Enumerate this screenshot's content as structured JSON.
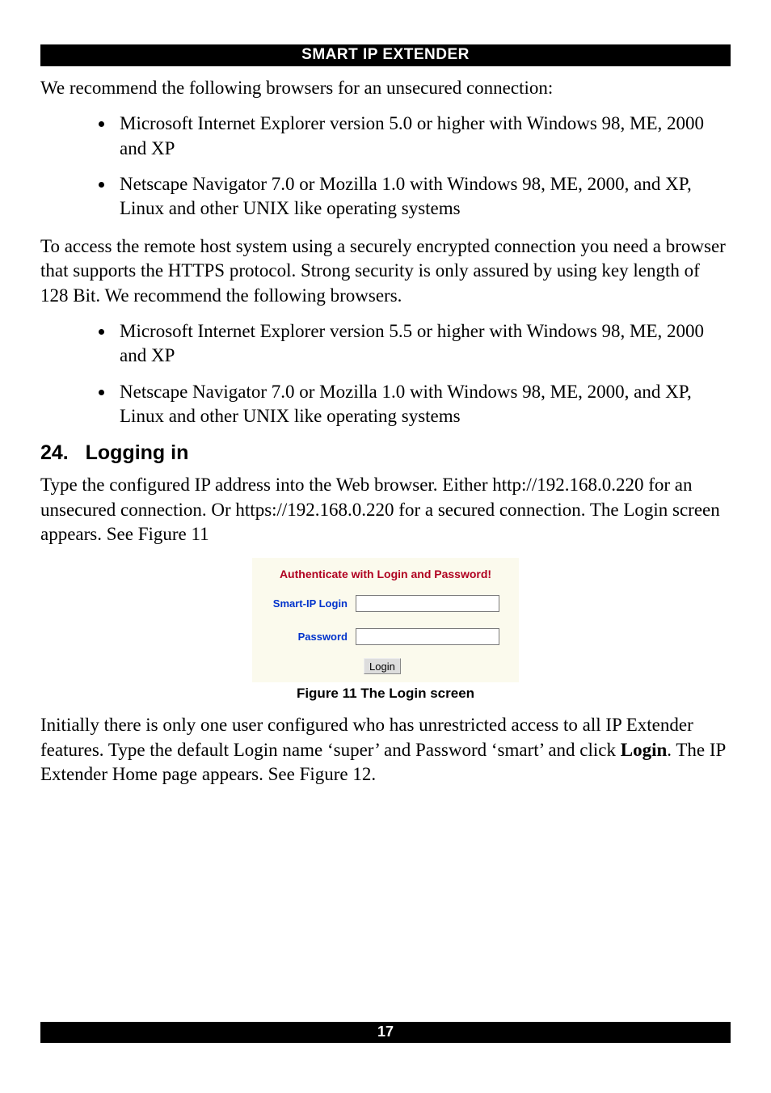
{
  "header": {
    "title": "SMART IP EXTENDER"
  },
  "intro1": "We recommend the following browsers for an unsecured connection:",
  "list1": {
    "items": [
      "Microsoft Internet Explorer version 5.0 or higher with Windows 98, ME, 2000 and XP",
      "Netscape Navigator 7.0 or Mozilla 1.0 with Windows 98, ME, 2000, and XP, Linux and other UNIX like operating systems"
    ]
  },
  "para2": "To access the remote host system using a securely encrypted connection you need a browser that supports the HTTPS protocol. Strong security is only assured by using key length of 128 Bit. We recommend the following browsers.",
  "list2": {
    "items": [
      "Microsoft Internet Explorer version 5.5 or higher with Windows 98, ME, 2000 and XP",
      "Netscape Navigator 7.0 or Mozilla 1.0 with Windows 98, ME, 2000, and XP, Linux and other UNIX like operating systems"
    ]
  },
  "section": {
    "number": "24.",
    "title": "Logging in"
  },
  "para3": "Type the configured IP address into the Web browser. Either http://192.168.0.220 for an unsecured connection. Or https://192.168.0.220 for a secured connection. The Login screen appears. See Figure 11",
  "login": {
    "banner": "Authenticate with Login and Password!",
    "label_login": "Smart-IP Login",
    "label_password": "Password",
    "button": "Login"
  },
  "figure_caption": "Figure 11 The Login screen",
  "para4_pre": "Initially there is only one user configured who has unrestricted access to all IP Extender features. Type the default Login name ‘super’ and Password ‘smart’ and click ",
  "para4_bold": "Login",
  "para4_post": ". The IP Extender Home page appears. See Figure 12.",
  "footer": {
    "page_number": "17"
  }
}
